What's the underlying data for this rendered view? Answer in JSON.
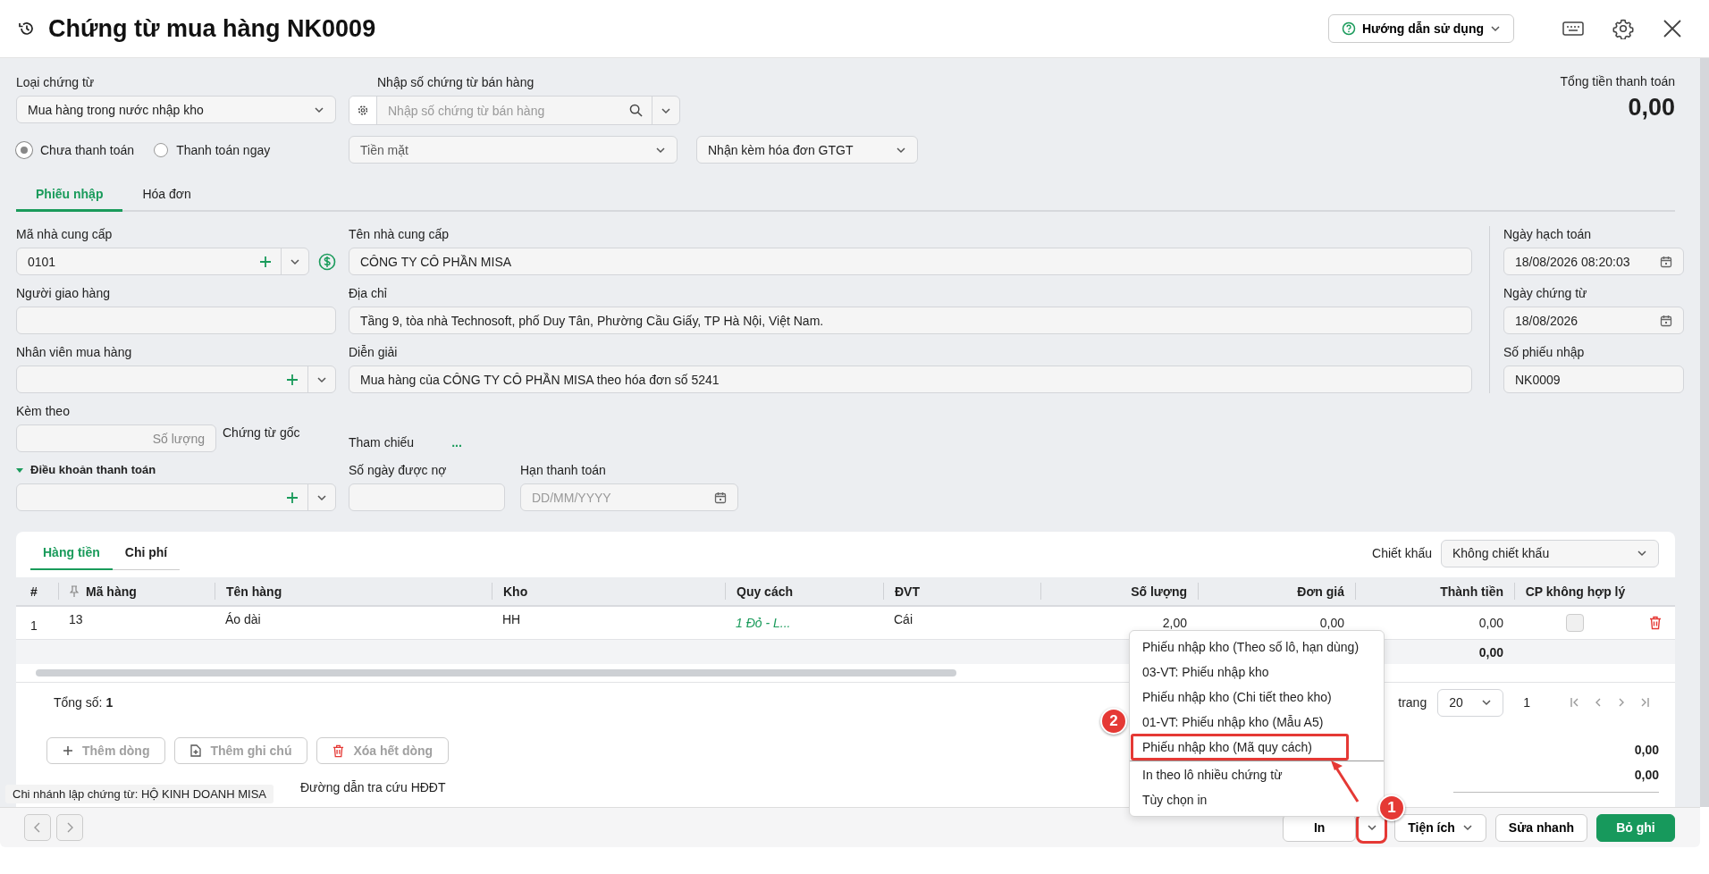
{
  "header": {
    "title": "Chứng từ mua hàng NK0009",
    "help_button": "Hướng dẫn sử dụng"
  },
  "voucher_type": {
    "label": "Loại chứng từ",
    "value": "Mua hàng trong nước nhập kho"
  },
  "sales_voucher_search": {
    "label": "Nhập số chứng từ bán hàng",
    "placeholder": "Nhập số chứng từ bán hàng"
  },
  "total": {
    "label": "Tổng tiền thanh toán",
    "value": "0,00"
  },
  "payment_status": [
    {
      "label": "Chưa thanh toán",
      "selected": true
    },
    {
      "label": "Thanh toán ngay",
      "selected": false
    }
  ],
  "payment_method": {
    "value": "Tiền mặt",
    "disabled": true
  },
  "invoice_option": {
    "value": "Nhận kèm hóa đơn GTGT"
  },
  "tabs": [
    {
      "label": "Phiếu nhập",
      "selected": true
    },
    {
      "label": "Hóa đơn",
      "selected": false
    }
  ],
  "supplier_code": {
    "label": "Mã nhà cung cấp",
    "value": "0101"
  },
  "supplier_name": {
    "label": "Tên nhà cung cấp",
    "value": "CÔNG TY CÔ PHẦN MISA"
  },
  "deliverer": {
    "label": "Người giao hàng"
  },
  "address": {
    "label": "Địa chỉ",
    "value": "Tầng 9, tòa nhà Technosoft, phố Duy Tân, Phường Cầu Giấy, TP Hà Nội, Việt Nam."
  },
  "buyer": {
    "label": "Nhân viên mua hàng"
  },
  "description": {
    "label": "Diễn giải",
    "value": "Mua hàng của CÔNG TY CÔ PHẦN MISA theo hóa đơn số 5241"
  },
  "attachments": {
    "label": "Kèm theo",
    "placeholder": "Số lượng",
    "suffix": "Chứng từ gốc"
  },
  "reference": {
    "label": "Tham chiếu",
    "link": "..."
  },
  "payment_terms": {
    "label": "Điều khoản thanh toán",
    "expanded": true
  },
  "credit_days": {
    "label": "Số ngày được nợ"
  },
  "due_date": {
    "label": "Hạn thanh toán",
    "placeholder": "DD/MM/YYYY"
  },
  "posting_date": {
    "label": "Ngày hạch toán",
    "value": "18/08/2026 08:20:03"
  },
  "voucher_date": {
    "label": "Ngày chứng từ",
    "value": "18/08/2026"
  },
  "receipt_number": {
    "label": "Số phiếu nhập",
    "value": "NK0009"
  },
  "grid": {
    "tabs": [
      {
        "label": "Hàng tiền",
        "selected": true
      },
      {
        "label": "Chi phí",
        "selected": false
      }
    ],
    "discount": {
      "label": "Chiết khấu",
      "value": "Không chiết khấu"
    },
    "columns": [
      {
        "label": "#",
        "kind": "index"
      },
      {
        "label": "Mã hàng",
        "kind": "text",
        "pinned": true
      },
      {
        "label": "Tên hàng",
        "kind": "text"
      },
      {
        "label": "Kho",
        "kind": "text"
      },
      {
        "label": "Quy cách",
        "kind": "link"
      },
      {
        "label": "ĐVT",
        "kind": "text"
      },
      {
        "label": "Số lượng",
        "kind": "number"
      },
      {
        "label": "Đơn giá",
        "kind": "number"
      },
      {
        "label": "Thành tiền",
        "kind": "number"
      },
      {
        "label": "CP không hợp lý",
        "kind": "checkbox"
      }
    ],
    "rows": [
      {
        "cells": [
          "1",
          "13",
          "Áo dài",
          "HH",
          "1 Đỏ - L...",
          "Cái",
          "2,00",
          "0,00",
          "0,00"
        ],
        "checked": false
      }
    ],
    "total_amount": "0,00",
    "count_label": "Tổng số:",
    "count": "1",
    "page_size_label": "trang",
    "page_size": "20",
    "page": "1"
  },
  "grid_buttons": [
    {
      "label": "Thêm dòng",
      "kind": "add",
      "disabled": true
    },
    {
      "label": "Thêm ghi chú",
      "kind": "note",
      "disabled": true
    },
    {
      "label": "Xóa hết dòng",
      "kind": "delete",
      "disabled": true
    }
  ],
  "summary_values": [
    "0,00",
    "0,00"
  ],
  "einvoice_link_label": "Đường dẫn tra cứu HĐĐT",
  "tooltip": "Chi nhánh lập chứng từ: HỘ KINH DOANH MISA",
  "footer": {
    "buttons": [
      {
        "label": "In",
        "kind": "split",
        "annotated": true
      },
      {
        "label": "Tiện ích",
        "kind": "menu"
      },
      {
        "label": "Sửa nhanh",
        "kind": "plain"
      },
      {
        "label": "Bỏ ghi",
        "kind": "primary"
      }
    ]
  },
  "print_menu": {
    "groups": [
      [
        {
          "label": "Phiếu nhập kho (Theo số lô, hạn dùng)",
          "annotated": false
        },
        {
          "label": "03-VT: Phiếu nhập kho",
          "annotated": false
        },
        {
          "label": "Phiếu nhập kho (Chi tiết theo kho)",
          "annotated": false
        },
        {
          "label": "01-VT: Phiếu nhập kho (Mẫu A5)",
          "annotated": false
        },
        {
          "label": "Phiếu nhập kho (Mã quy cách)",
          "annotated": true
        }
      ],
      [
        {
          "label": "In theo lô nhiều chứng từ",
          "annotated": false
        },
        {
          "label": "Tùy chọn in",
          "annotated": false
        }
      ]
    ]
  },
  "annotations": [
    {
      "label": "1"
    },
    {
      "label": "2"
    }
  ]
}
